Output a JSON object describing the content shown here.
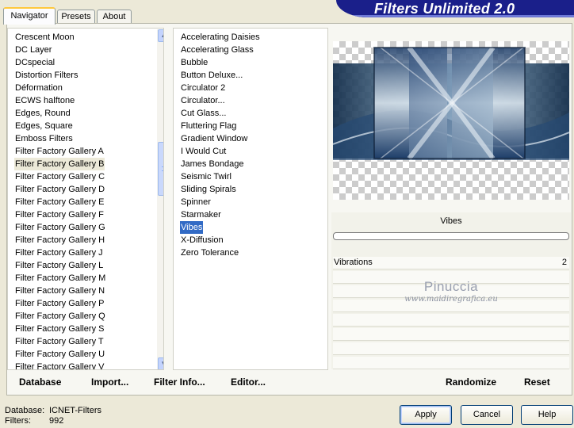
{
  "tabs": [
    "Navigator",
    "Presets",
    "About"
  ],
  "title": "Filters Unlimited 2.0",
  "categories": [
    "Crescent Moon",
    "DC Layer",
    "DCspecial",
    "Distortion Filters",
    "Déformation",
    "ECWS halftone",
    "Edges, Round",
    "Edges, Square",
    "Emboss Filters",
    "Filter Factory Gallery A",
    "Filter Factory Gallery B",
    "Filter Factory Gallery C",
    "Filter Factory Gallery D",
    "Filter Factory Gallery E",
    "Filter Factory Gallery F",
    "Filter Factory Gallery G",
    "Filter Factory Gallery H",
    "Filter Factory Gallery J",
    "Filter Factory Gallery L",
    "Filter Factory Gallery M",
    "Filter Factory Gallery N",
    "Filter Factory Gallery P",
    "Filter Factory Gallery Q",
    "Filter Factory Gallery S",
    "Filter Factory Gallery T",
    "Filter Factory Gallery U",
    "Filter Factory Gallery V"
  ],
  "selected_category": "Filter Factory Gallery B",
  "filters": [
    "Accelerating Daisies",
    "Accelerating Glass",
    "Bubble",
    "Button Deluxe...",
    "Circulator 2",
    "Circulator...",
    "Cut Glass...",
    "Fluttering Flag",
    "Gradient Window",
    "I Would Cut",
    "James Bondage",
    "Seismic Twirl",
    "Sliding Spirals",
    "Spinner",
    "Starmaker",
    "Vibes",
    "X-Diffusion",
    "Zero Tolerance"
  ],
  "selected_filter": "Vibes",
  "preview": {
    "filter_name": "Vibes",
    "progress": 0
  },
  "params": [
    {
      "label": "Vibrations",
      "value": "2"
    }
  ],
  "watermark": {
    "name": "Pinuccia",
    "url": "www.maidiregrafica.eu"
  },
  "toolbar": {
    "database": "Database",
    "import": "Import...",
    "filter_info": "Filter Info...",
    "editor": "Editor...",
    "randomize": "Randomize",
    "reset": "Reset"
  },
  "footer": {
    "database_label": "Database:",
    "database_value": "ICNET-Filters",
    "filters_label": "Filters:",
    "filters_value": "992"
  },
  "buttons": {
    "apply": "Apply",
    "cancel": "Cancel",
    "help": "Help"
  },
  "colors": {
    "selection": "#316ac5",
    "banner": "#1a1f8a",
    "background": "#ece9d8"
  }
}
